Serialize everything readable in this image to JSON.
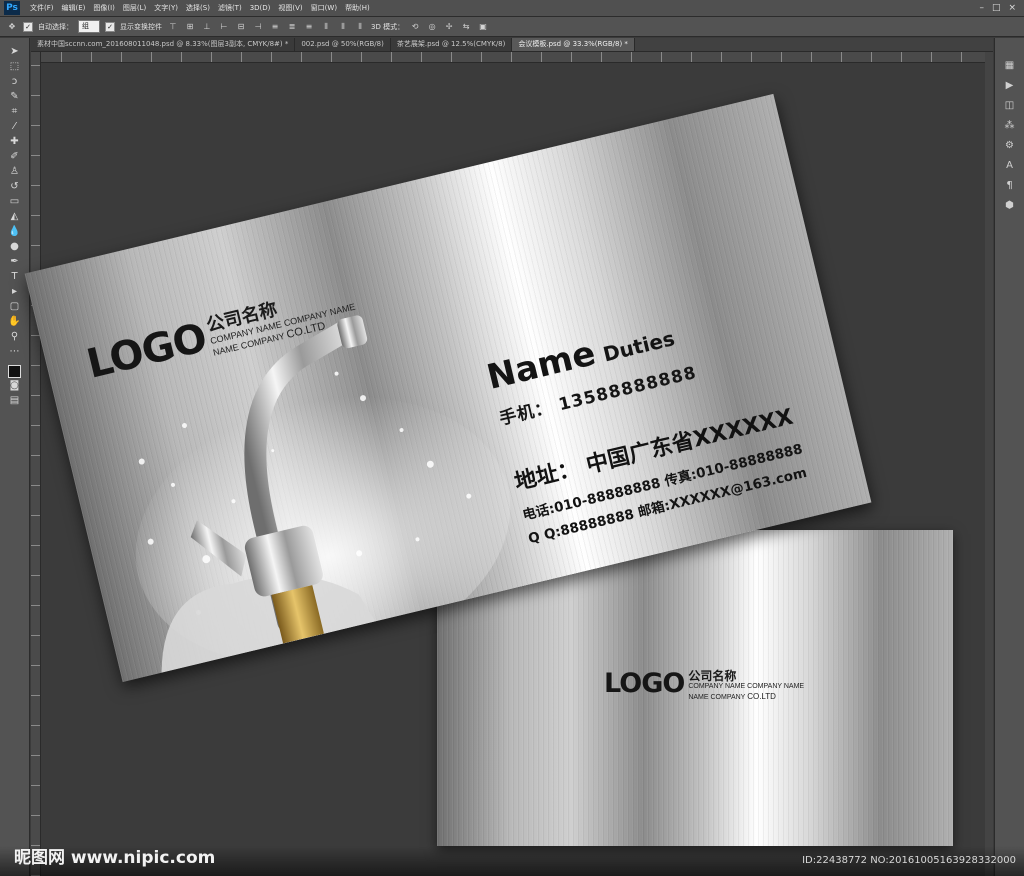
{
  "app": {
    "logo": "Ps"
  },
  "menu": [
    "文件(F)",
    "编辑(E)",
    "图像(I)",
    "图层(L)",
    "文字(Y)",
    "选择(S)",
    "滤镜(T)",
    "3D(D)",
    "视图(V)",
    "窗口(W)",
    "帮助(H)"
  ],
  "options_bar": {
    "auto_select_label": "自动选择：",
    "auto_select_value": "组",
    "show_transform_label": "显示变换控件",
    "mode_3d_label": "3D 模式："
  },
  "tabs": [
    {
      "label": "素材中国sccnn.com_20160801104​8.psd @ 8.33%(图层3副本, CMYK/8#) *"
    },
    {
      "label": "002.psd @ 50%(RGB/8)"
    },
    {
      "label": "茶艺展架.psd @ 12.5%(CMYK/8)"
    },
    {
      "label": "会议模板.psd @ 33.3%(RGB/8) *"
    }
  ],
  "card_front": {
    "logo": "LOGO",
    "company_cn": "公司名称",
    "company_en_line1": "COMPANY NAME COMPANY NAME",
    "company_en_line2": "NAME COMPANY",
    "company_en_suffix": "CO.LTD",
    "name": "Name",
    "duties": "Duties",
    "mobile": "手机：  13588888888",
    "address": "地址：  中国广东省XXXXXX",
    "phone_fax": "电话:010-88888888  传真:010-88888888",
    "qq_email": "Q Q:88888888  邮箱:XXXXXX@163.com"
  },
  "card_back": {
    "logo": "LOGO",
    "company_cn": "公司名称",
    "company_en_line1": "COMPANY NAME COMPANY NAME",
    "company_en_line2": "NAME COMPANY",
    "company_en_suffix": "CO.LTD"
  },
  "watermark": {
    "site": "昵图网 www.nipic.com",
    "id": "ID:22438772 NO:20161005163928332000"
  }
}
